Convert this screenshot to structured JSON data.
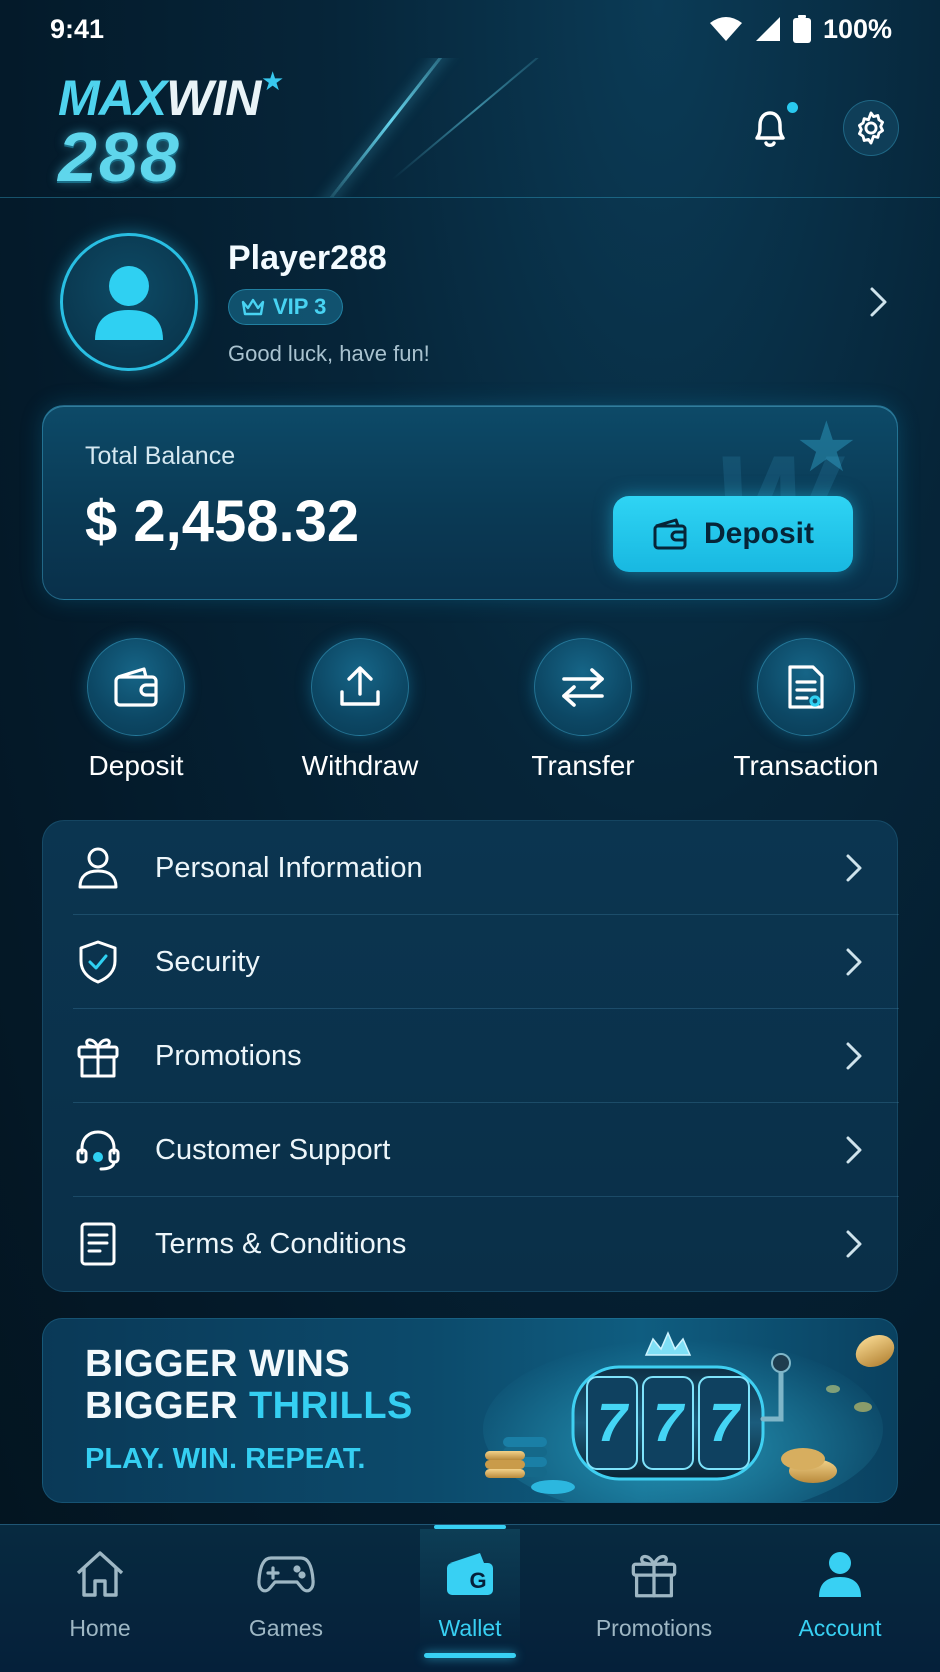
{
  "status_bar": {
    "time": "9:41",
    "battery": "100%"
  },
  "brand": {
    "logo_line1_a": "MAX",
    "logo_line1_b": "WIN",
    "logo_line2": "288"
  },
  "header": {
    "notification_icon": "bell-icon",
    "settings_icon": "gear-icon",
    "has_unread": true
  },
  "profile": {
    "name": "Player288",
    "vip_level": "VIP 3",
    "tagline": "Good luck, have fun!"
  },
  "balance": {
    "label": "Total Balance",
    "amount": "$ 2,458.32",
    "deposit_label": "Deposit"
  },
  "quick_actions": [
    {
      "label": "Deposit",
      "icon": "wallet-icon"
    },
    {
      "label": "Withdraw",
      "icon": "upload-icon"
    },
    {
      "label": "Transfer",
      "icon": "transfer-icon"
    },
    {
      "label": "Transaction",
      "icon": "receipt-icon"
    }
  ],
  "menu": [
    {
      "label": "Personal Information",
      "icon": "user-icon"
    },
    {
      "label": "Security",
      "icon": "shield-icon"
    },
    {
      "label": "Promotions",
      "icon": "gift-icon"
    },
    {
      "label": "Customer Support",
      "icon": "headset-icon"
    },
    {
      "label": "Terms & Conditions",
      "icon": "document-icon"
    }
  ],
  "banner": {
    "line1": "BIGGER WINS",
    "line2_a": "BIGGER",
    "line2_b": "THRILLS",
    "line3": "PLAY. WIN. REPEAT."
  },
  "bottom_nav": [
    {
      "label": "Home",
      "icon": "home-icon"
    },
    {
      "label": "Games",
      "icon": "gamepad-icon"
    },
    {
      "label": "Wallet",
      "icon": "wallet-icon",
      "active": true
    },
    {
      "label": "Promotions",
      "icon": "gift-icon"
    },
    {
      "label": "Account",
      "icon": "user-icon",
      "highlight": true
    }
  ],
  "colors": {
    "accent": "#38d0f3",
    "background": "#041a2a",
    "card": "#0a3a55"
  }
}
